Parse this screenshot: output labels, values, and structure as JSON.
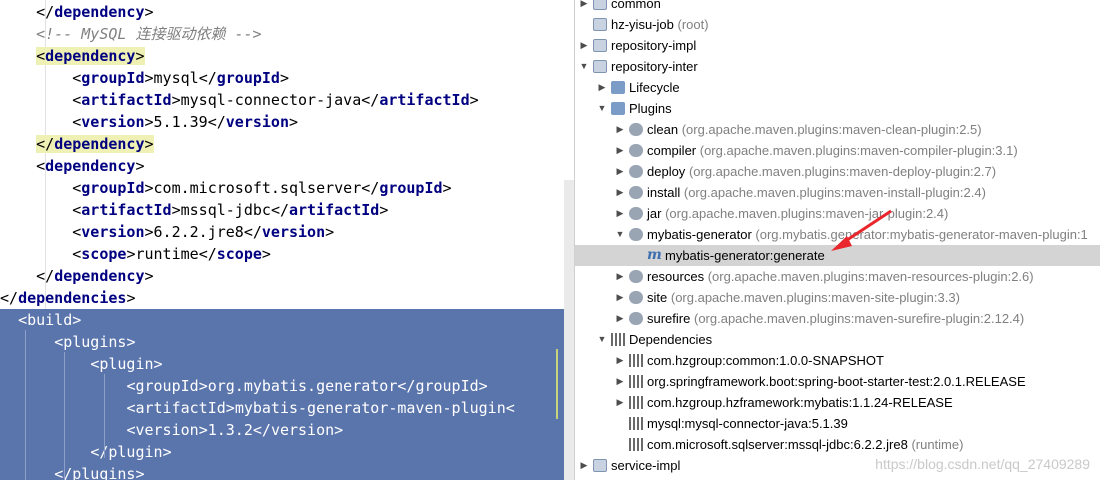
{
  "editor": {
    "lines": [
      {
        "indent": "    ",
        "kind": "close",
        "tag": "dependency"
      },
      {
        "indent": "    ",
        "kind": "comment",
        "text": "<!-- MySQL 连接驱动依赖 -->"
      },
      {
        "indent": "    ",
        "kind": "open",
        "tag": "dependency",
        "highlight": true
      },
      {
        "indent": "        ",
        "kind": "elem",
        "tag": "groupId",
        "text": "mysql"
      },
      {
        "indent": "        ",
        "kind": "elem",
        "tag": "artifactId",
        "text": "mysql-connector-java"
      },
      {
        "indent": "        ",
        "kind": "elem",
        "tag": "version",
        "text": "5.1.39"
      },
      {
        "indent": "    ",
        "kind": "close",
        "tag": "dependency",
        "highlight": true
      },
      {
        "indent": "    ",
        "kind": "open",
        "tag": "dependency"
      },
      {
        "indent": "        ",
        "kind": "elem",
        "tag": "groupId",
        "text": "com.microsoft.sqlserver"
      },
      {
        "indent": "        ",
        "kind": "elem",
        "tag": "artifactId",
        "text": "mssql-jdbc"
      },
      {
        "indent": "        ",
        "kind": "elem",
        "tag": "version",
        "text": "6.2.2.jre8"
      },
      {
        "indent": "        ",
        "kind": "elem",
        "tag": "scope",
        "text": "runtime"
      },
      {
        "indent": "    ",
        "kind": "close",
        "tag": "dependency"
      },
      {
        "indent": "",
        "kind": "close",
        "tag": "dependencies"
      },
      {
        "indent": "  ",
        "kind": "open",
        "tag": "build",
        "selected": true
      },
      {
        "indent": "      ",
        "kind": "open",
        "tag": "plugins",
        "selected": true
      },
      {
        "indent": "          ",
        "kind": "open",
        "tag": "plugin",
        "selected": true
      },
      {
        "indent": "              ",
        "kind": "elem",
        "tag": "groupId",
        "text": "org.mybatis.generator",
        "selected": true
      },
      {
        "indent": "              ",
        "kind": "elem",
        "tag": "artifactId",
        "text": "mybatis-generator-maven-plugin",
        "close_text": "<",
        "selected": true
      },
      {
        "indent": "              ",
        "kind": "elem",
        "tag": "version",
        "text": "1.3.2",
        "selected": true
      },
      {
        "indent": "          ",
        "kind": "close",
        "tag": "plugin",
        "selected": true
      },
      {
        "indent": "      ",
        "kind": "close",
        "tag": "plugins",
        "selected": true
      }
    ]
  },
  "maven": {
    "rows": [
      {
        "level": 0,
        "arrow": "right",
        "icon": "module",
        "label": "common",
        "note": ""
      },
      {
        "level": 0,
        "arrow": "none",
        "icon": "module",
        "label": "hz-yisu-job",
        "note": "(root)"
      },
      {
        "level": 0,
        "arrow": "right",
        "icon": "module",
        "label": "repository-impl",
        "note": ""
      },
      {
        "level": 0,
        "arrow": "down",
        "icon": "module",
        "label": "repository-inter",
        "note": ""
      },
      {
        "level": 1,
        "arrow": "right",
        "icon": "folder",
        "label": "Lifecycle",
        "note": ""
      },
      {
        "level": 1,
        "arrow": "down",
        "icon": "folder",
        "label": "Plugins",
        "note": ""
      },
      {
        "level": 2,
        "arrow": "right",
        "icon": "gear",
        "label": "clean",
        "note": "(org.apache.maven.plugins:maven-clean-plugin:2.5)"
      },
      {
        "level": 2,
        "arrow": "right",
        "icon": "gear",
        "label": "compiler",
        "note": "(org.apache.maven.plugins:maven-compiler-plugin:3.1)"
      },
      {
        "level": 2,
        "arrow": "right",
        "icon": "gear",
        "label": "deploy",
        "note": "(org.apache.maven.plugins:maven-deploy-plugin:2.7)"
      },
      {
        "level": 2,
        "arrow": "right",
        "icon": "gear",
        "label": "install",
        "note": "(org.apache.maven.plugins:maven-install-plugin:2.4)"
      },
      {
        "level": 2,
        "arrow": "right",
        "icon": "gear",
        "label": "jar",
        "note": "(org.apache.maven.plugins:maven-jar-plugin:2.4)"
      },
      {
        "level": 2,
        "arrow": "down",
        "icon": "gear",
        "label": "mybatis-generator",
        "note": "(org.mybatis.generator:mybatis-generator-maven-plugin:1"
      },
      {
        "level": 3,
        "arrow": "none",
        "icon": "m",
        "label": "mybatis-generator:generate",
        "note": "",
        "selected": true
      },
      {
        "level": 2,
        "arrow": "right",
        "icon": "gear",
        "label": "resources",
        "note": "(org.apache.maven.plugins:maven-resources-plugin:2.6)"
      },
      {
        "level": 2,
        "arrow": "right",
        "icon": "gear",
        "label": "site",
        "note": "(org.apache.maven.plugins:maven-site-plugin:3.3)"
      },
      {
        "level": 2,
        "arrow": "right",
        "icon": "gear",
        "label": "surefire",
        "note": "(org.apache.maven.plugins:maven-surefire-plugin:2.12.4)"
      },
      {
        "level": 1,
        "arrow": "down",
        "icon": "lib",
        "label": "Dependencies",
        "note": ""
      },
      {
        "level": 2,
        "arrow": "right",
        "icon": "lib",
        "label": "com.hzgroup:common:1.0.0-SNAPSHOT",
        "note": ""
      },
      {
        "level": 2,
        "arrow": "right",
        "icon": "lib",
        "label": "org.springframework.boot:spring-boot-starter-test:2.0.1.RELEASE",
        "note": ""
      },
      {
        "level": 2,
        "arrow": "right",
        "icon": "lib",
        "label": "com.hzgroup.hzframework:mybatis:1.1.24-RELEASE",
        "note": ""
      },
      {
        "level": 2,
        "arrow": "none",
        "icon": "lib",
        "label": "mysql:mysql-connector-java:5.1.39",
        "note": ""
      },
      {
        "level": 2,
        "arrow": "none",
        "icon": "lib",
        "label": "com.microsoft.sqlserver:mssql-jdbc:6.2.2.jre8",
        "note": "(runtime)"
      },
      {
        "level": 0,
        "arrow": "right",
        "icon": "module",
        "label": "service-impl",
        "note": ""
      }
    ],
    "watermark": "https://blog.csdn.net/qq_27409289"
  },
  "colors": {
    "selection": "#5a74ac",
    "tag_name": "#000080",
    "comment": "#808080",
    "tree_selected": "#d4d4d4",
    "annotation_arrow": "#e8262c"
  }
}
